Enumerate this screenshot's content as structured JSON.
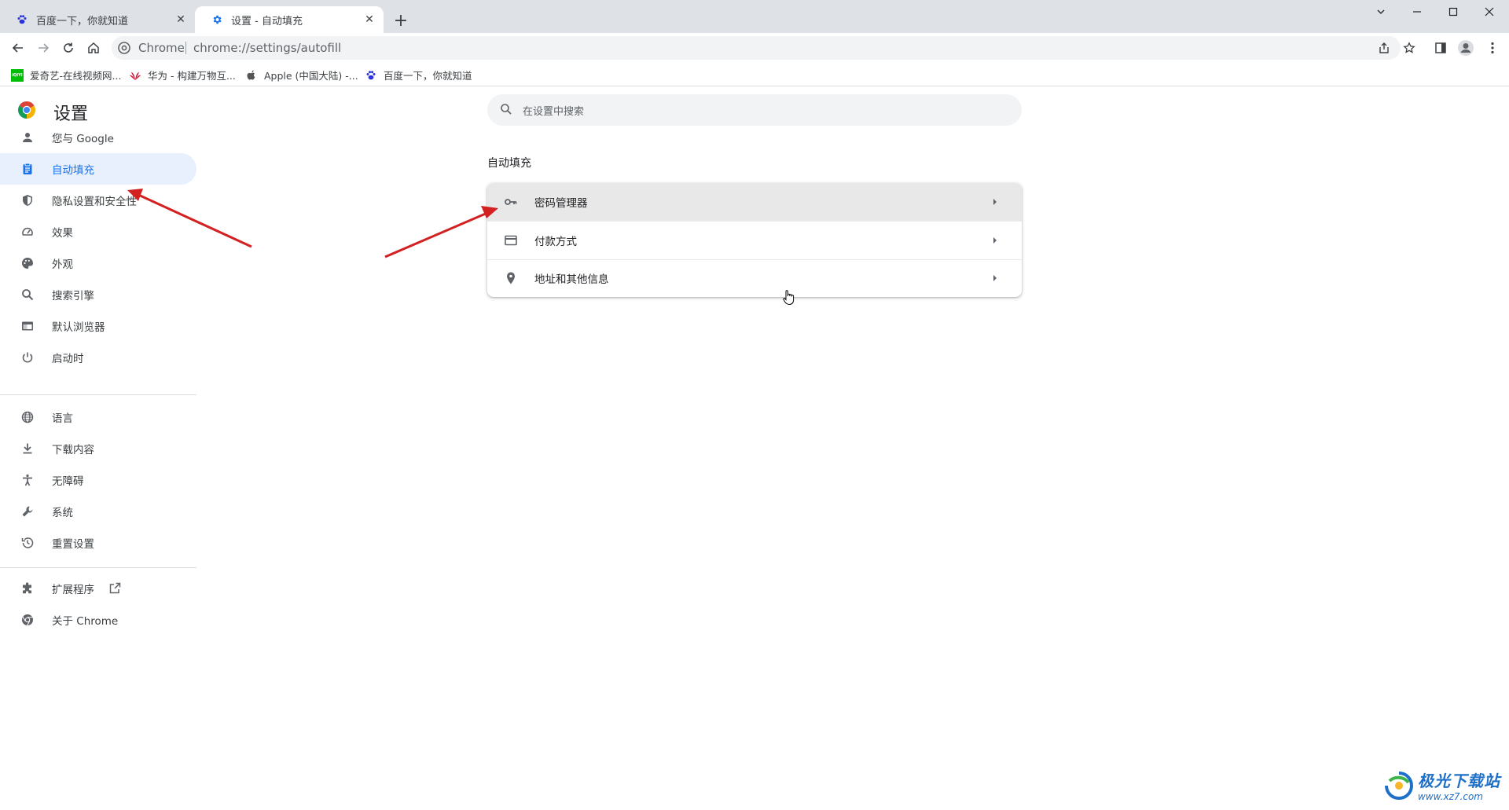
{
  "browser": {
    "tabs": [
      {
        "title": "百度一下，你就知道",
        "icon": "baidu-paw-icon",
        "active": false
      },
      {
        "title": "设置 - 自动填充",
        "icon": "gear-icon",
        "active": true
      }
    ],
    "new_tab_glyph": "+",
    "close_glyph": "✕",
    "omnibox": {
      "scheme_label": "Chrome",
      "url": "chrome://settings/autofill"
    },
    "bookmarks": [
      {
        "label": "爱奇艺-在线视频网...",
        "icon": "iqiyi-icon",
        "icon_text": "iQIYI"
      },
      {
        "label": "华为 - 构建万物互...",
        "icon": "huawei-icon"
      },
      {
        "label": "Apple (中国大陆) -...",
        "icon": "apple-icon"
      },
      {
        "label": "百度一下，你就知道",
        "icon": "baidu-paw-icon"
      }
    ]
  },
  "settings": {
    "title": "设置",
    "search_placeholder": "在设置中搜索",
    "nav_groups": [
      [
        {
          "label": "您与 Google",
          "icon": "person-icon"
        },
        {
          "label": "自动填充",
          "icon": "clipboard-icon",
          "active": true
        },
        {
          "label": "隐私设置和安全性",
          "icon": "shield-icon"
        },
        {
          "label": "效果",
          "icon": "speedometer-icon"
        },
        {
          "label": "外观",
          "icon": "palette-icon"
        },
        {
          "label": "搜索引擎",
          "icon": "search-icon"
        },
        {
          "label": "默认浏览器",
          "icon": "browser-window-icon"
        },
        {
          "label": "启动时",
          "icon": "power-icon"
        }
      ],
      [
        {
          "label": "语言",
          "icon": "globe-icon"
        },
        {
          "label": "下载内容",
          "icon": "download-icon"
        },
        {
          "label": "无障碍",
          "icon": "accessibility-icon"
        },
        {
          "label": "系统",
          "icon": "wrench-icon"
        },
        {
          "label": "重置设置",
          "icon": "history-icon"
        }
      ],
      [
        {
          "label": "扩展程序",
          "icon": "puzzle-icon",
          "external": true
        },
        {
          "label": "关于 Chrome",
          "icon": "chrome-icon"
        }
      ]
    ],
    "section_title": "自动填充",
    "rows": [
      {
        "label": "密码管理器",
        "icon": "key-icon",
        "hovered": true
      },
      {
        "label": "付款方式",
        "icon": "credit-card-icon"
      },
      {
        "label": "地址和其他信息",
        "icon": "location-pin-icon"
      }
    ]
  },
  "watermark": {
    "name": "极光下载站",
    "url": "www.xz7.com"
  },
  "colors": {
    "accent": "#1a73e8",
    "annotation_arrow": "#d32020",
    "active_nav_bg": "#e8f0fe"
  }
}
